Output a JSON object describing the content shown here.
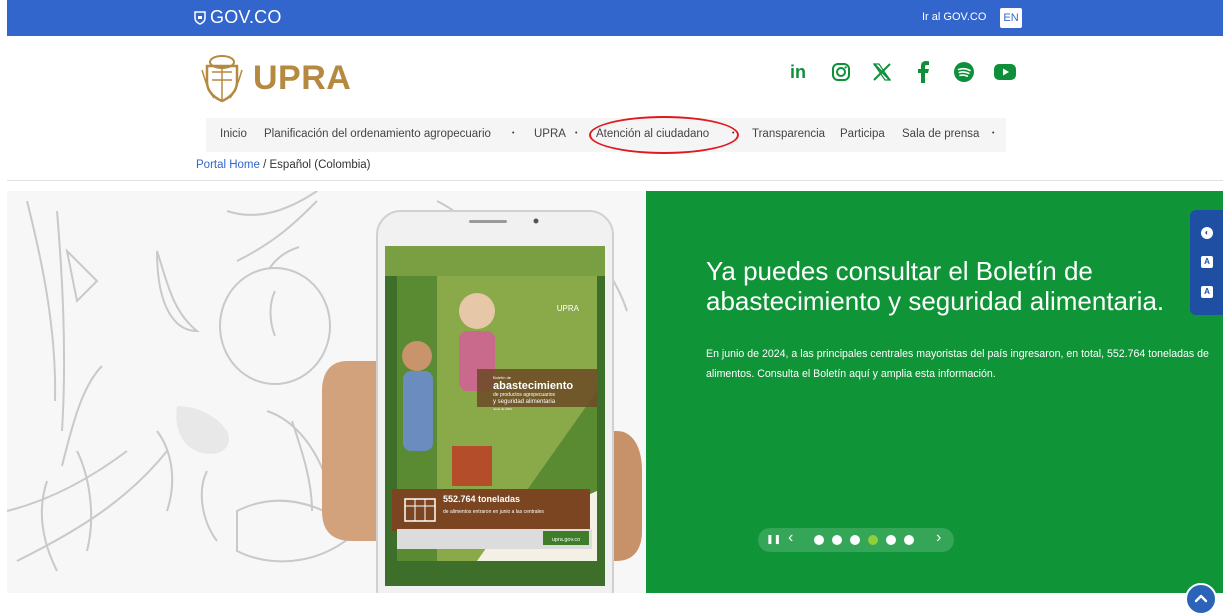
{
  "topbar": {
    "logo_text": "GOV.CO",
    "gov_link": "Ir al GOV.CO",
    "lang": "EN"
  },
  "brand": {
    "name": "UPRA"
  },
  "socials": [
    {
      "icon": "linkedin-icon"
    },
    {
      "icon": "instagram-icon"
    },
    {
      "icon": "x-icon"
    },
    {
      "icon": "facebook-icon"
    },
    {
      "icon": "spotify-icon"
    },
    {
      "icon": "youtube-icon"
    }
  ],
  "nav": {
    "inicio": "Inicio",
    "planificacion": "Planificación del ordenamiento agropecuario",
    "upra": "UPRA",
    "atencion": "Atención al ciudadano",
    "transparencia": "Transparencia",
    "participa": "Participa",
    "sala": "Sala de prensa",
    "caret": "•"
  },
  "breadcrumb": {
    "home": "Portal Home",
    "separator": " / ",
    "current": "Español (Colombia)"
  },
  "hero": {
    "title": "Ya puedes consultar el Boletín de abastecimiento y seguridad alimentaria.",
    "description": "En junio de 2024, a las principales centrales mayoristas del país ingresaron, en total, 552.764 toneladas de alimentos. Consulta el Boletín aquí y amplia esta información.",
    "phone": {
      "brand": "UPRA",
      "label_small": "Boletín de",
      "label_big": "abastecimiento",
      "label_line2": "de productos agropecuarios",
      "label_line3": "y seguridad alimentaria",
      "label_date": "Junio de 2024",
      "stat_bold": "552.764 toneladas",
      "stat_rest": " de alimentos entraron en junio a las centrales",
      "footer_url": "upra.gov.co"
    }
  },
  "carousel": {
    "pause": "❚❚",
    "prev": "‹",
    "next": "›",
    "dots": 6,
    "active_index": 3
  },
  "accessibility": {
    "contrast": "◐",
    "text_smaller": "A",
    "text_larger": "A"
  },
  "colors": {
    "gov_blue": "#3366cc",
    "brand_gold": "#b5893f",
    "hero_green": "#0f9438",
    "social_green": "#0e8f3a",
    "annotation_red": "#e0191e"
  }
}
